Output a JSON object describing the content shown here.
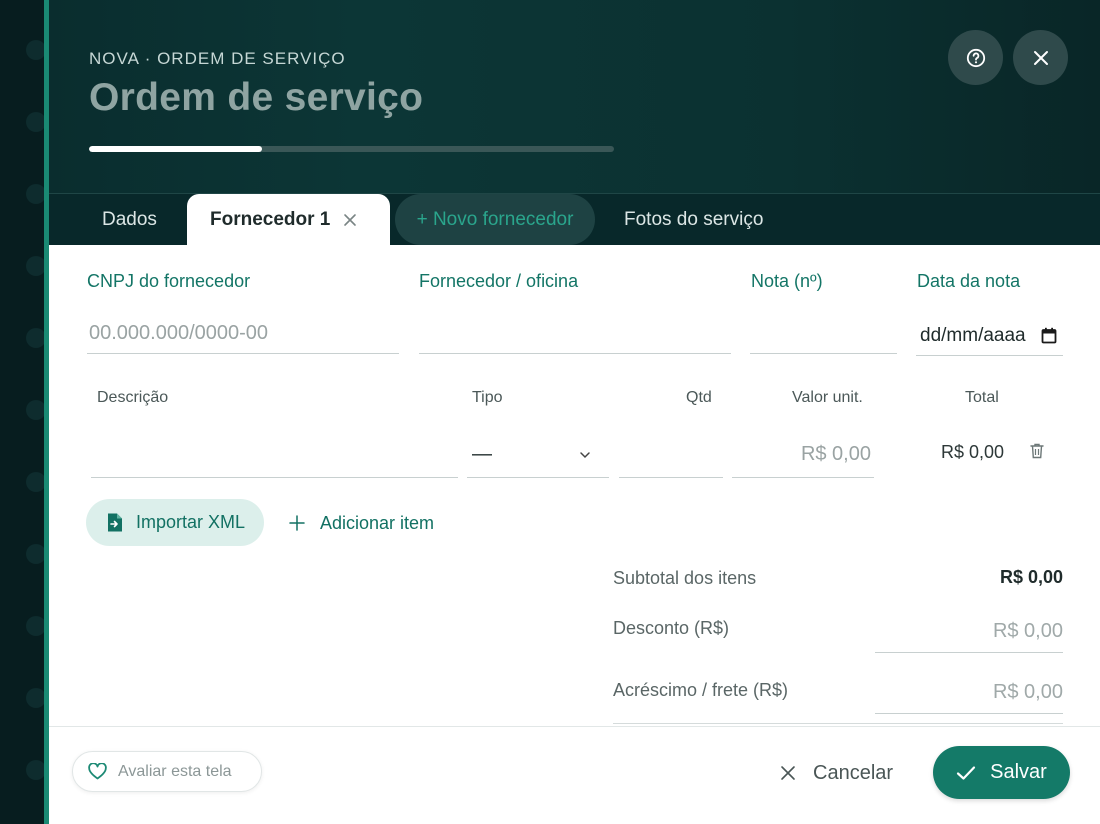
{
  "header": {
    "eyebrow": "NOVA · ORDEM DE SERVIÇO",
    "title": "Ordem de serviço",
    "progress": 0.33,
    "help_icon": "help-circle-icon",
    "close_icon": "close-icon"
  },
  "tabs": [
    {
      "label": "Dados"
    },
    {
      "label": "Fornecedor 1",
      "active": true
    },
    {
      "label": "+ Novo fornecedor"
    },
    {
      "label": "Fotos do serviço"
    }
  ],
  "supplier": {
    "cnpj_label": "CNPJ do fornecedor",
    "cnpj_placeholder": "00.000.000/0000-00",
    "cnpj_value": "",
    "name_label": "Fornecedor / oficina",
    "name_value": "",
    "invoice_label": "Nota (nº)",
    "invoice_value": "",
    "date_label": "Data da nota",
    "date_placeholder": "dd/mm/aaaa"
  },
  "items": {
    "columns": [
      "Descrição",
      "Tipo",
      "Qtd",
      "Valor unit.",
      "Total"
    ],
    "rows": [
      {
        "description": "",
        "type": "—",
        "qty": "",
        "unit_placeholder": "R$ 0,00",
        "total": "R$ 0,00"
      }
    ]
  },
  "actions": {
    "import_xml": "Importar XML",
    "add_item": "Adicionar item"
  },
  "summary": {
    "subtotal_label": "Subtotal dos itens",
    "subtotal_value": "R$ 0,00",
    "discount_label": "Desconto (R$)",
    "discount_placeholder": "R$ 0,00",
    "surcharge_label": "Acréscimo / frete (R$)",
    "surcharge_placeholder": "R$ 0,00"
  },
  "footer": {
    "rate_label": "Avaliar esta tela",
    "cancel_label": "Cancelar",
    "save_label": "Salvar"
  },
  "colors": {
    "accent": "#147a68",
    "header_bg": "#0c3636",
    "label": "#137566"
  }
}
